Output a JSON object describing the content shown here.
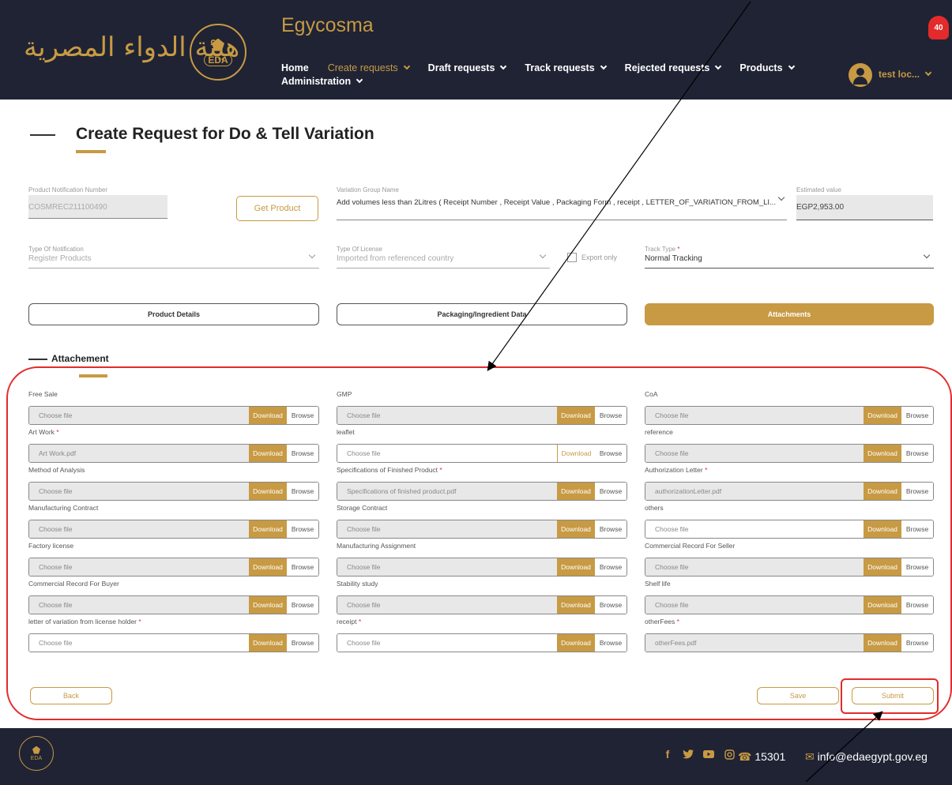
{
  "header": {
    "arabic_name": "هيئة الدواء المصرية",
    "logo_text": "EDA",
    "brand": "Egycosma",
    "nav": [
      {
        "label": "Home",
        "active": false,
        "dropdown": false
      },
      {
        "label": "Create requests",
        "active": true,
        "dropdown": true
      },
      {
        "label": "Draft requests",
        "active": false,
        "dropdown": true
      },
      {
        "label": "Track requests",
        "active": false,
        "dropdown": true
      },
      {
        "label": "Rejected requests",
        "active": false,
        "dropdown": true
      },
      {
        "label": "Products",
        "active": false,
        "dropdown": true
      },
      {
        "label": "Administration",
        "active": false,
        "dropdown": true
      }
    ],
    "notification_count": "40",
    "user_name": "test loc...",
    "icons": {
      "notification": "bell-icon",
      "user": "user-avatar-icon"
    }
  },
  "page": {
    "title": "Create Request for Do & Tell Variation"
  },
  "form": {
    "product_notification_number": {
      "label": "Product Notification Number",
      "value": "COSMREC211100490"
    },
    "get_product_label": "Get Product",
    "variation_group_name": {
      "label": "Variation Group Name",
      "value": "Add volumes less than 2Litres ( Receipt Number , Receipt Value , Packaging Form , receipt , LETTER_OF_VARIATION_FROM_LI..."
    },
    "estimated_value": {
      "label": "Estimated value",
      "value": "EGP2,953.00"
    },
    "type_of_notification": {
      "label": "Type Of Notification",
      "value": "Register Products"
    },
    "type_of_license": {
      "label": "Type Of License",
      "value": "Imported from referenced country"
    },
    "export_only": {
      "label": "Export only",
      "checked": false
    },
    "track_type": {
      "label": "Track Type",
      "required": "*",
      "value": "Normal Tracking"
    }
  },
  "tabs": [
    {
      "label": "Product Details",
      "active": false
    },
    {
      "label": "Packaging/Ingredient Data",
      "active": false
    },
    {
      "label": "Attachments",
      "active": true
    }
  ],
  "attachments": {
    "section_title": "Attachement",
    "download_label": "Download",
    "browse_label": "Browse",
    "items": [
      {
        "label": "Free Sale",
        "value": "Choose file",
        "required": ""
      },
      {
        "label": "GMP",
        "value": "Choose file",
        "required": ""
      },
      {
        "label": "CoA",
        "value": "Choose file",
        "required": ""
      },
      {
        "label": "Art Work",
        "value": "Art Work.pdf",
        "required": "*"
      },
      {
        "label": "leaflet",
        "value": "Choose file",
        "required": ""
      },
      {
        "label": "reference",
        "value": "Choose file",
        "required": ""
      },
      {
        "label": "Method of Analysis",
        "value": "Choose file",
        "required": ""
      },
      {
        "label": "Specifications of Finished Product",
        "value": "Specifications of finished product.pdf",
        "required": "*"
      },
      {
        "label": "Authorization Letter",
        "value": "authorizationLetter.pdf",
        "required": "*"
      },
      {
        "label": "Manufacturing Contract",
        "value": "Choose file",
        "required": ""
      },
      {
        "label": "Storage Contract",
        "value": "Choose file",
        "required": ""
      },
      {
        "label": "others",
        "value": "Choose file",
        "required": ""
      },
      {
        "label": "Factory license",
        "value": "Choose file",
        "required": ""
      },
      {
        "label": "Manufacturing Assignment",
        "value": "Choose file",
        "required": ""
      },
      {
        "label": "Commercial Record For Seller",
        "value": "Choose file",
        "required": ""
      },
      {
        "label": "Commercial Record For Buyer",
        "value": "Choose file",
        "required": ""
      },
      {
        "label": "Stability study",
        "value": "Choose file",
        "required": ""
      },
      {
        "label": "Shelf life",
        "value": "Choose file",
        "required": ""
      },
      {
        "label": "letter of variation from license holder",
        "value": "Choose file",
        "required": "*"
      },
      {
        "label": "receipt",
        "value": "Choose file",
        "required": "*"
      },
      {
        "label": "otherFees",
        "value": "otherFees.pdf",
        "required": "*"
      }
    ]
  },
  "actions": {
    "back": "Back",
    "save": "Save",
    "submit": "Submit"
  },
  "footer": {
    "logo_text": "EDA",
    "social_icons": [
      "facebook-icon",
      "twitter-icon",
      "youtube-icon",
      "instagram-icon"
    ],
    "phone": "15301",
    "email": "info@edaegypt.gov.eg"
  },
  "colors": {
    "header_bg": "#1f2334",
    "accent": "#c79a43",
    "annotation": "#e32b2b"
  }
}
